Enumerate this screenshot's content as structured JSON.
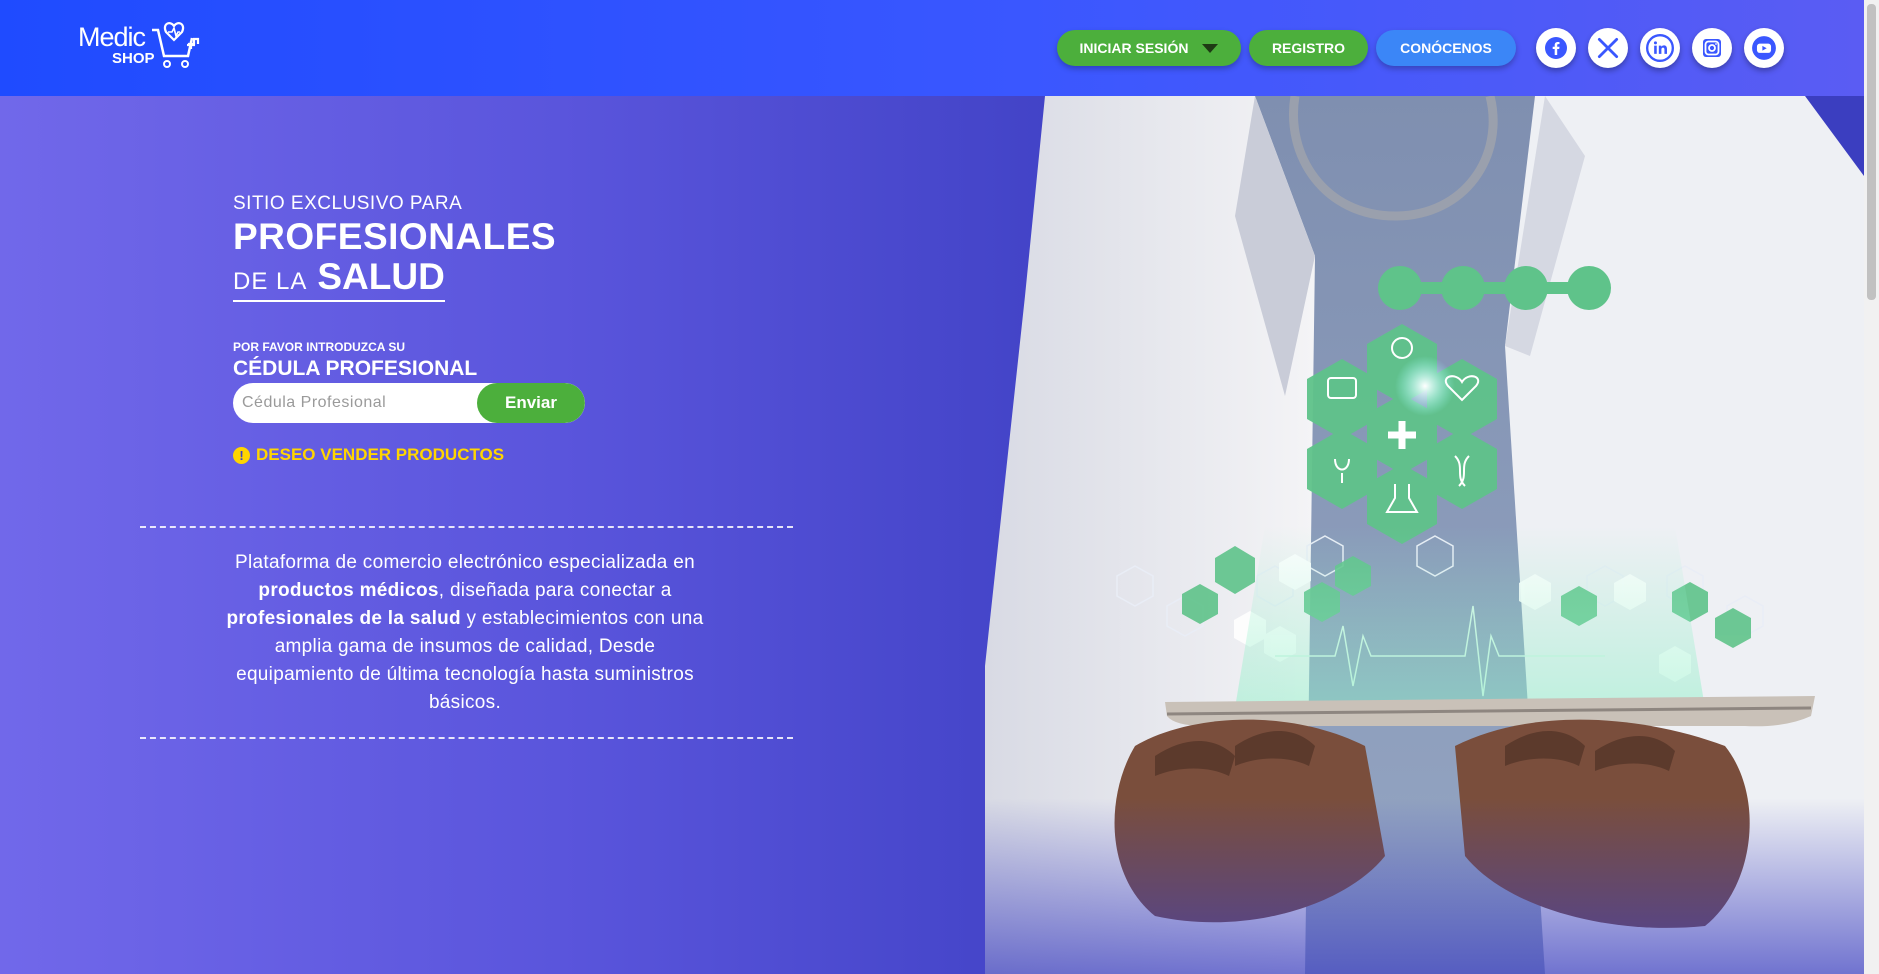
{
  "header": {
    "logo_word1": "Medic",
    "logo_word2": "SHOP",
    "nav": {
      "login_label": "INICIAR SESIÓN",
      "register_label": "REGISTRO",
      "about_label": "CONÓCENOS"
    },
    "social": [
      "facebook-icon",
      "x-icon",
      "linkedin-icon",
      "instagram-icon",
      "youtube-icon"
    ]
  },
  "hero": {
    "exclusive_label": "SITIO EXCLUSIVO PARA",
    "title_line1": "PROFESIONALES",
    "title_prefix": "DE LA",
    "title_line2": "SALUD",
    "prompt_small": "POR FAVOR INTRODUZCA SU",
    "prompt_big": "CÉDULA PROFESIONAL",
    "cedula_placeholder": "Cédula Profesional",
    "submit_label": "Enviar",
    "sell_link": "DESEO VENDER PRODUCTOS",
    "description": {
      "p1": "Plataforma de comercio electrónico especializada en",
      "b1": "productos médicos",
      "p2": ", diseñada para conectar a",
      "b2": "profesionales de la salud",
      "p3": " y establecimientos con una amplia gama de insumos de calidad, Desde equipamiento de última tecnología hasta suministros básicos."
    }
  },
  "colors": {
    "header_blue": "#1f4bff",
    "green": "#4caf3c",
    "light_blue": "#3b86f7",
    "accent_yellow": "#ffd500",
    "hero_purple": "#5a55dc"
  }
}
